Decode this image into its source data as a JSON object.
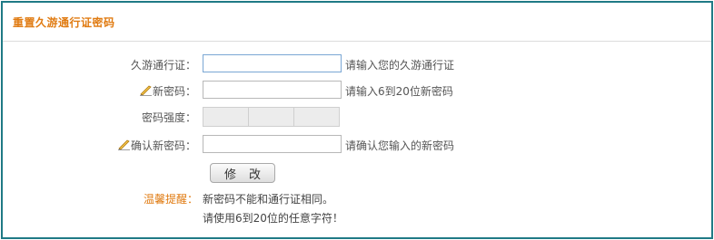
{
  "header": {
    "title": "重置久游通行证密码"
  },
  "form": {
    "account": {
      "label": "久游通行证：",
      "value": "",
      "hint": "请输入您的久游通行证"
    },
    "new_password": {
      "label": "新密码：",
      "value": "",
      "hint": "请输入6到20位新密码"
    },
    "strength": {
      "label": "密码强度："
    },
    "confirm_password": {
      "label": "确认新密码：",
      "value": "",
      "hint": "请确认您输入的新密码"
    },
    "submit_label": "修改"
  },
  "tips": {
    "title": "温馨提醒：",
    "lines": [
      "新密码不能和通行证相同。",
      "请使用6到20位的任意字符！"
    ]
  },
  "colors": {
    "accent": "#e07b12",
    "border": "#1f7a85"
  }
}
